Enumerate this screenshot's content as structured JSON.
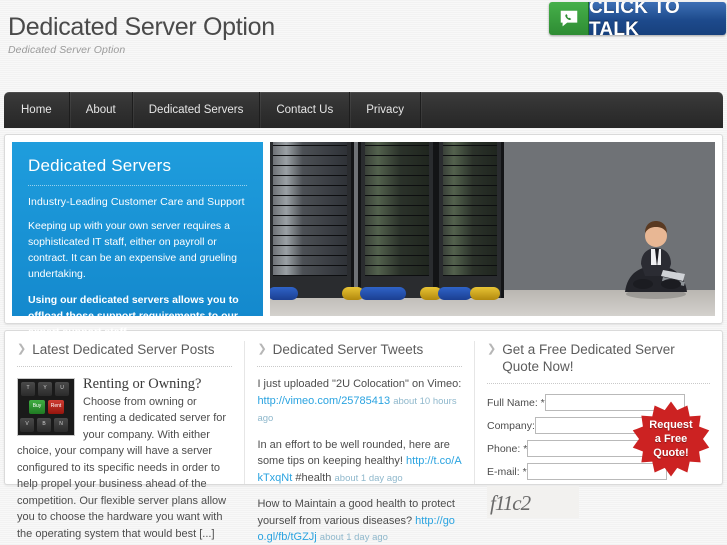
{
  "header": {
    "title": "Dedicated Server Option",
    "tagline": "Dedicated Server Option",
    "click_to_talk": {
      "label": "CLICK TO TALK",
      "icon": "phone-icon",
      "icon_color": "#3aa33e",
      "label_color": "#1d4a8c"
    }
  },
  "nav": {
    "items": [
      {
        "label": "Home"
      },
      {
        "label": "About"
      },
      {
        "label": "Dedicated Servers"
      },
      {
        "label": "Contact Us"
      },
      {
        "label": "Privacy"
      }
    ]
  },
  "hero": {
    "accent_color": "#1a96d8",
    "heading": "Dedicated Servers",
    "subheading": "Industry-Leading Customer Care and Support",
    "body": "Keeping up with your own server requires a sophisticated IT staff, either on payroll or contract. It can be an expensive and grueling undertaking.",
    "highlight": "Using our dedicated servers allows you to offload those support requirements to our expert support staff.",
    "image_alt": "server-racks-with-businessman-photo"
  },
  "posts": {
    "heading": "Latest Dedicated Server Posts",
    "marker": "chevron-right-icon",
    "items": [
      {
        "thumb_alt": "keyboard-buy-rent-keys-thumbnail",
        "thumb_keys": [
          "T",
          "Y",
          "U",
          "Buy",
          "Rent",
          "V",
          "B",
          "N"
        ],
        "title": "Renting or Owning?",
        "body": "Choose from owning or renting a dedicated server for your company. With either choice, your company will have a server configured to its specific needs in order to help propel your business ahead of the competition. Our flexible server plans allow you to choose the hardware you want with the operating system that would best [...]"
      }
    ]
  },
  "tweets": {
    "heading": "Dedicated Server Tweets",
    "marker": "chevron-right-icon",
    "items": [
      {
        "text": "I just uploaded \"2U Colocation\" on Vimeo: ",
        "link": "http://vimeo.com/25785413",
        "suffix": "",
        "ago": "about 10 hours ago"
      },
      {
        "text": "In an effort to be well rounded, here are some tips on keeping healthy! ",
        "link": "http://t.co/AkTxqNt",
        "suffix": " #health",
        "ago": "about 1 day ago"
      },
      {
        "text": "How to Maintain a good health to protect yourself from various diseases? ",
        "link": "http://goo.gl/fb/tGZJj",
        "suffix": "",
        "ago": "about 1 day ago"
      }
    ]
  },
  "quote": {
    "heading": "Get a Free Dedicated Server Quote Now!",
    "marker": "chevron-right-icon",
    "fields": [
      {
        "label": "Full Name: *",
        "value": "",
        "placeholder": ""
      },
      {
        "label": "Company:",
        "value": "",
        "placeholder": ""
      },
      {
        "label": "Phone: *",
        "value": "",
        "placeholder": ""
      },
      {
        "label": "E-mail: *",
        "value": "",
        "placeholder": ""
      }
    ],
    "captcha_text": "f11c2",
    "badge": {
      "line1": "Request",
      "line2": "a Free",
      "line3": "Quote!",
      "color": "#cc2222"
    }
  }
}
